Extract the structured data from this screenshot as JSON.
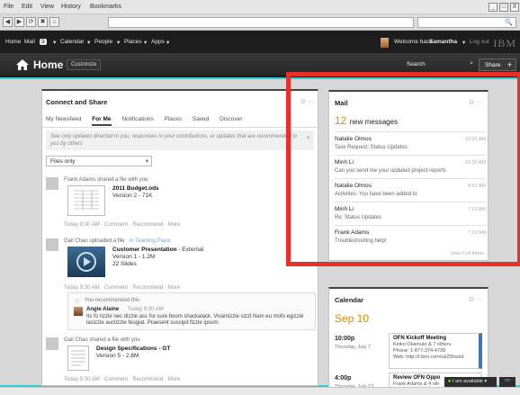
{
  "browser": {
    "menu": [
      "File",
      "Edit",
      "View",
      "History",
      "Bookmarks"
    ],
    "window_controls": [
      "_",
      "□",
      "X"
    ],
    "nav_buttons": [
      "◀",
      "▶",
      "⟳",
      "✖",
      "⌂"
    ],
    "search_glyph": "🔍"
  },
  "topnav": {
    "items": [
      "Home",
      "Mail",
      "Calendar",
      "People",
      "Places",
      "Apps"
    ],
    "mail_badge": "3",
    "welcome_text": "Welcome back",
    "user": "Samantha",
    "logout": "Log out",
    "brand": "IBM"
  },
  "homebar": {
    "title": "Home",
    "customize": "Customize",
    "search": "Search",
    "share": "Share"
  },
  "connect": {
    "title": "Connect and Share",
    "tabs": [
      "My Newsfeed",
      "For Me",
      "Notifications",
      "Places",
      "Saved",
      "Discover"
    ],
    "active_tab": "For Me",
    "note": "See only updates directed to you, responses to your contributions, or updates that are recommended to you by others",
    "filter": "Files only",
    "entries": [
      {
        "header_user": "Frank Adams",
        "header_action": "shared a file with you",
        "file": "2011 Budget.ods",
        "line2": "Version 2 - 71K",
        "meta": "Today 9:30 AM · Comment · Recommend · More"
      },
      {
        "header_user": "Gail Chao",
        "header_action": "uploaded a file",
        "header_place": "· In Teaming Place",
        "file": "Customer Presentation",
        "file_suffix": " - External",
        "line2": "Version 1 - 1.2M",
        "line3": "22 Slides",
        "meta": "Today 9:30 AM · Comment · Recommend · More"
      },
      {
        "header_user": "Gail Chao",
        "header_action": "shared a file with you",
        "file": "Design Specifications - GT",
        "line2": "Version 5 - 2.8M",
        "meta": "Today 9:30 AM · Comment · Recommend · More"
      }
    ],
    "recommendation": {
      "text": "You recommended this",
      "author": "Angie Alaine",
      "time": "Today 9:30 AM",
      "body": "Its fo rizzle nec dizzle ass for sure boom shackalack. Vivamizzle sizzl Nam eu mofo egizzle lacizzle auctizzle feugiat. Praesent suscipit fizzle ipsum."
    }
  },
  "mail": {
    "title": "Mail",
    "count": "12",
    "count_label": "new messages",
    "rows": [
      {
        "name": "Natalie Olmos",
        "subject": "Task Request: Status Updates",
        "time": "10:31 AM"
      },
      {
        "name": "Minh Li",
        "subject": "Can you send me your updated project reports",
        "time": "10:30 AM"
      },
      {
        "name": "Natalie Olmos",
        "subject": "Activities: You have been added to",
        "time": "8:52 AM"
      },
      {
        "name": "Minh Li",
        "subject": "Re: Status Updates",
        "time": "7:22 AM"
      },
      {
        "name": "Frank Adams",
        "subject": "Troubleshooting help!",
        "time": "7:22 AM"
      }
    ],
    "view_all": "View Full Inbox"
  },
  "calendar": {
    "title": "Calendar",
    "day": "Sep 10",
    "events": [
      {
        "time": "10:00p",
        "date": "Thursday, July 7",
        "title": "OFN Kickoff Meeting",
        "who": "Keiko Okamuto & 7 others",
        "phone": "Phone: 1-877-374-4739",
        "web": "Web: http://t.ibm.com/uk23hsoid"
      },
      {
        "time": "4:00p",
        "date": "Thursday, July 13",
        "title": "Review OFN Oppo",
        "who": "Frank Adams & 4 oth",
        "phone": "",
        "web": ""
      }
    ]
  },
  "chat": {
    "status": "I am available",
    "icon": "chat-icon"
  },
  "colors": {
    "accent": "#e08a00",
    "highlight": "#e8302b",
    "bg": "#2fd0d0"
  }
}
